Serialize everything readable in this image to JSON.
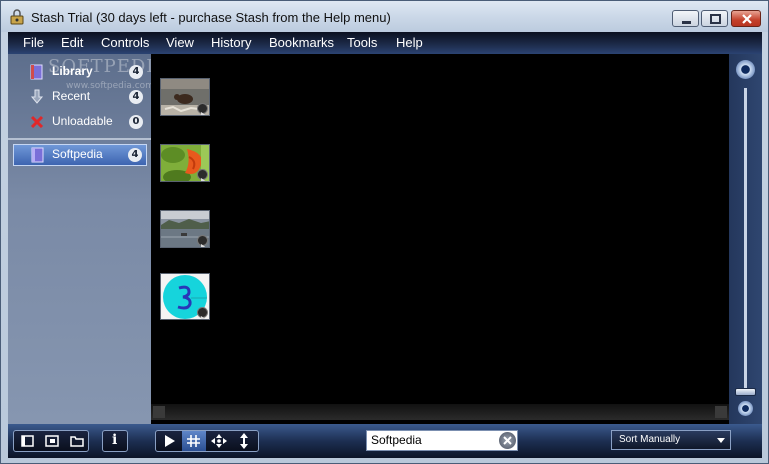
{
  "window": {
    "title": "Stash Trial (30 days left - purchase Stash from the Help menu)"
  },
  "menu": [
    "File",
    "Edit",
    "Controls",
    "View",
    "History",
    "Bookmarks",
    "Tools",
    "Help"
  ],
  "sidebar": {
    "watermark": "SOFTPEDIA",
    "watermark_url": "www.softpedia.com",
    "items": [
      {
        "label": "Library",
        "count": "4",
        "icon": "library-book-icon"
      },
      {
        "label": "Recent",
        "count": "4",
        "icon": "recent-arrow-icon"
      },
      {
        "label": "Unloadable",
        "count": "0",
        "icon": "unloadable-x-icon"
      }
    ],
    "collections": [
      {
        "label": "Softpedia",
        "count": "4",
        "icon": "collection-book-icon"
      }
    ]
  },
  "thumbnails": [
    {
      "name": "bear-video"
    },
    {
      "name": "flower-video"
    },
    {
      "name": "lake-video"
    },
    {
      "name": "cyan-3-video"
    }
  ],
  "toolbar": {
    "search_value": "Softpedia",
    "sort_label": "Sort Manually",
    "info_label": "i"
  },
  "colors": {
    "menubar": "#1c2a48",
    "viewer_bg": "#000000",
    "selected": "#3d64b0"
  }
}
